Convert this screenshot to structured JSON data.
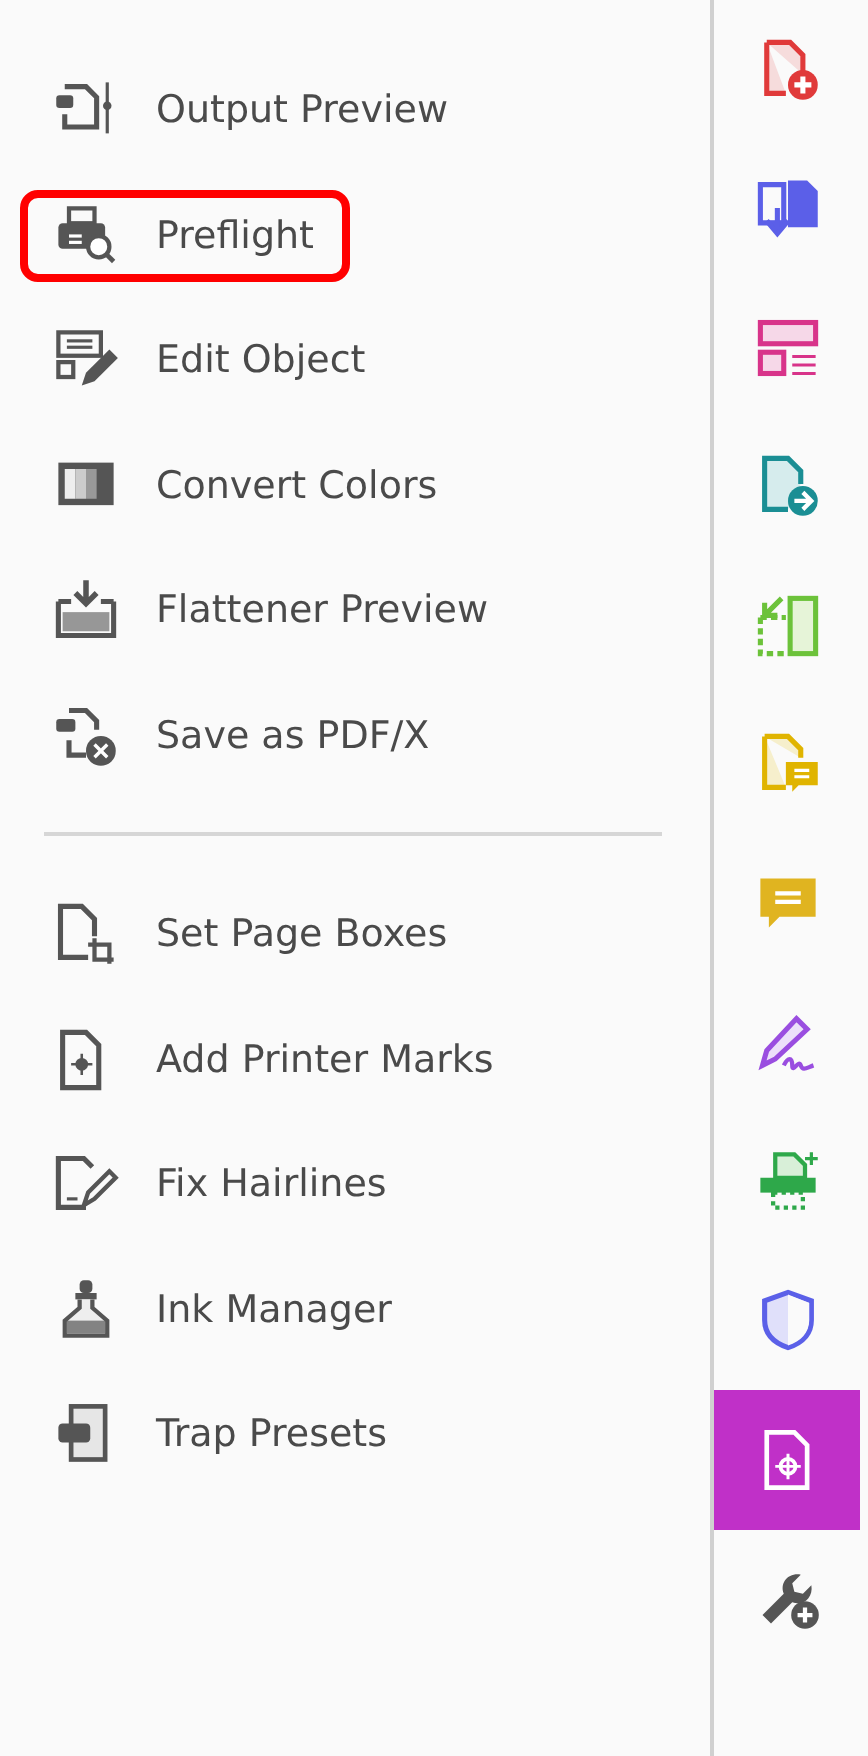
{
  "groups": [
    {
      "items": [
        {
          "kind": "output",
          "label": "Output Preview",
          "highlighted": false
        },
        {
          "kind": "preflight",
          "label": "Preflight",
          "highlighted": true
        },
        {
          "kind": "edit",
          "label": "Edit Object",
          "highlighted": false
        },
        {
          "kind": "convert",
          "label": "Convert Colors",
          "highlighted": false
        },
        {
          "kind": "flatten",
          "label": "Flattener Preview",
          "highlighted": false
        },
        {
          "kind": "pdfx",
          "label": "Save as PDF/X",
          "highlighted": false
        }
      ]
    },
    {
      "items": [
        {
          "kind": "boxes",
          "label": "Set Page Boxes",
          "highlighted": false
        },
        {
          "kind": "marks",
          "label": "Add Printer Marks",
          "highlighted": false
        },
        {
          "kind": "hairline",
          "label": "Fix Hairlines",
          "highlighted": false
        },
        {
          "kind": "ink",
          "label": "Ink Manager",
          "highlighted": false
        },
        {
          "kind": "trap",
          "label": "Trap Presets",
          "highlighted": false
        }
      ]
    }
  ],
  "tool_rail": [
    {
      "kind": "create",
      "selected": false
    },
    {
      "kind": "combine",
      "selected": false
    },
    {
      "kind": "organize",
      "selected": false
    },
    {
      "kind": "export",
      "selected": false
    },
    {
      "kind": "compress",
      "selected": false
    },
    {
      "kind": "review",
      "selected": false
    },
    {
      "kind": "comment",
      "selected": false
    },
    {
      "kind": "sign",
      "selected": false
    },
    {
      "kind": "scan",
      "selected": false
    },
    {
      "kind": "protect",
      "selected": false
    },
    {
      "kind": "print",
      "selected": true
    },
    {
      "kind": "more",
      "selected": false
    }
  ]
}
